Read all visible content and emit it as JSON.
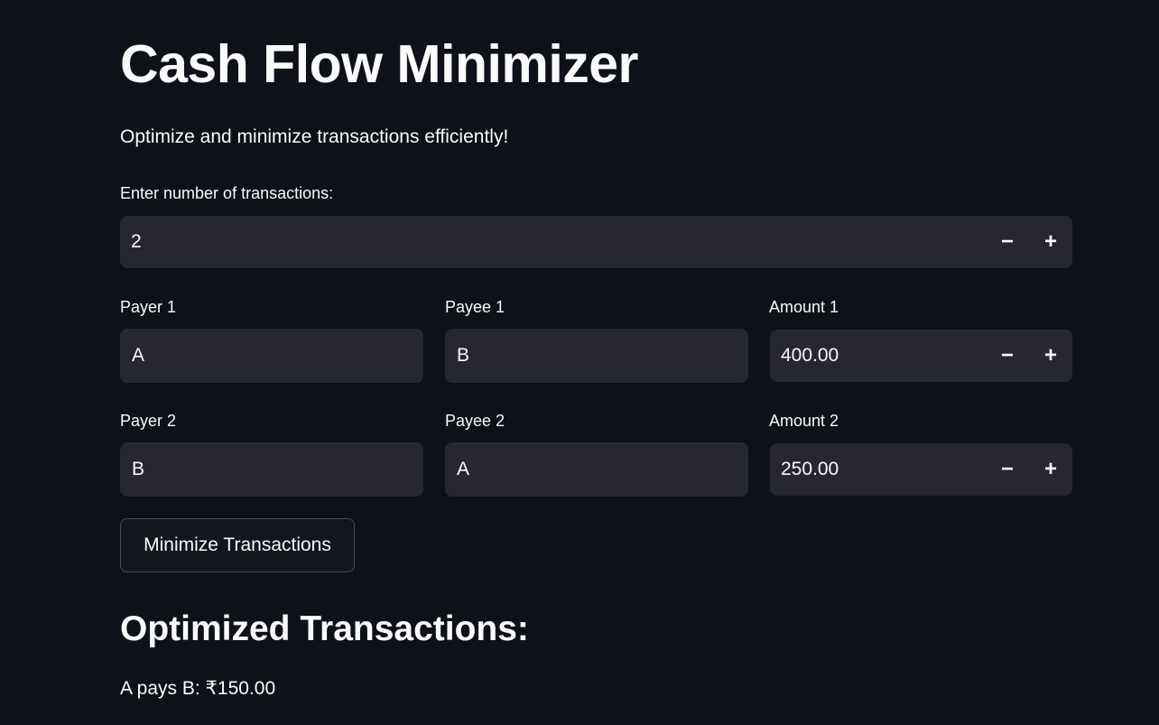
{
  "header": {
    "title": "Cash Flow Minimizer",
    "subtitle": "Optimize and minimize transactions efficiently!"
  },
  "count_input": {
    "label": "Enter number of transactions:",
    "value": "2",
    "minus": "−",
    "plus": "+"
  },
  "transactions": [
    {
      "payer_label": "Payer 1",
      "payer_value": "A",
      "payee_label": "Payee 1",
      "payee_value": "B",
      "amount_label": "Amount 1",
      "amount_value": "400.00"
    },
    {
      "payer_label": "Payer 2",
      "payer_value": "B",
      "payee_label": "Payee 2",
      "payee_value": "A",
      "amount_label": "Amount 2",
      "amount_value": "250.00"
    }
  ],
  "action": {
    "minimize_label": "Minimize Transactions"
  },
  "results": {
    "heading": "Optimized Transactions:",
    "items": [
      "A pays B: ₹150.00"
    ]
  },
  "colors": {
    "background": "#0e1117",
    "input_bg": "#262730",
    "text": "#fafafa"
  }
}
